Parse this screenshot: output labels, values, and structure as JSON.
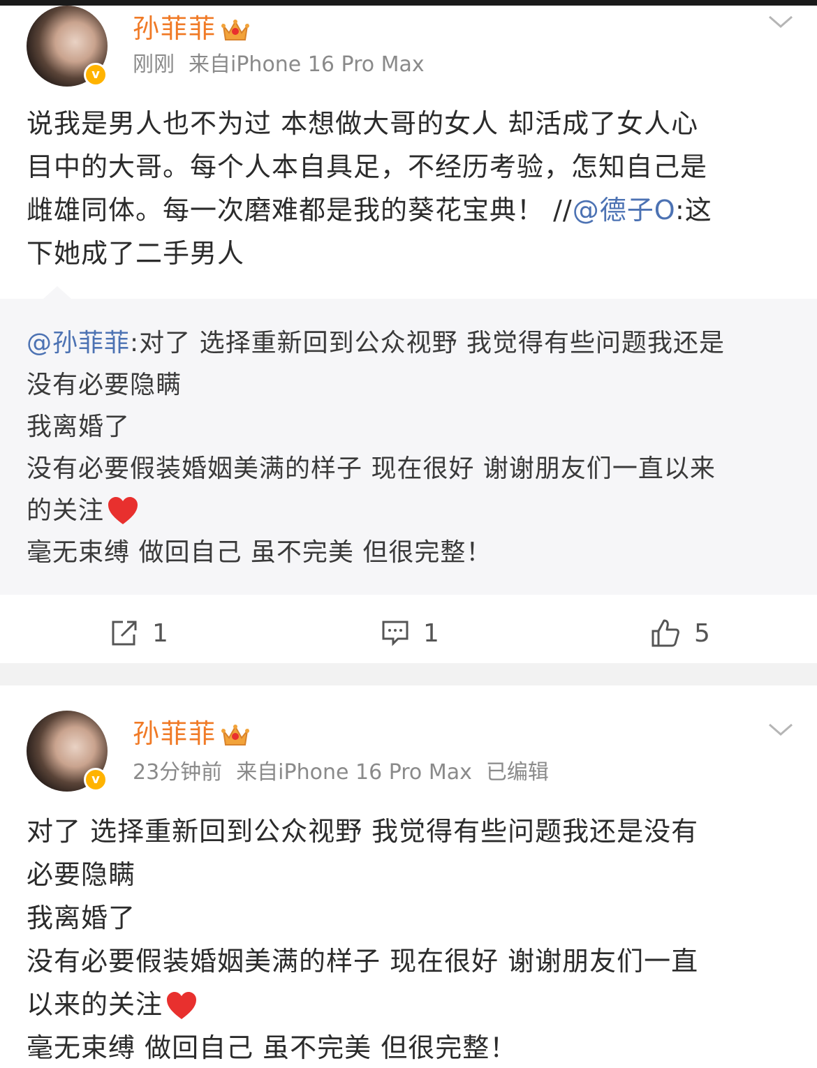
{
  "posts": [
    {
      "username": "孙菲菲",
      "time": "刚刚",
      "source": "来自iPhone 16 Pro Max",
      "edited": "",
      "content_lines": [
        "说我是男人也不为过 本想做大哥的女人 却活成了女人心",
        "目中的大哥。每个人本自具足，不经历考验，怎知自己是",
        "雌雄同体。每一次磨难都是我的葵花宝典！",
        "下她成了二手男人"
      ],
      "content_line3_suffix": "//",
      "content_mention": "@德子O",
      "content_after_mention": ":这",
      "repost": {
        "mention": "@孙菲菲",
        "lines": [
          ":对了 选择重新回到公众视野 我觉得有些问题我还是",
          "没有必要隐瞒",
          "我离婚了",
          "没有必要假装婚姻美满的样子 现在很好 谢谢朋友们一直以来",
          "的关注",
          "毫无束缚 做回自己 虽不完美 但很完整！"
        ]
      },
      "actions": {
        "repost_count": "1",
        "comment_count": "1",
        "like_count": "5"
      }
    },
    {
      "username": "孙菲菲",
      "time": "23分钟前",
      "source": "来自iPhone 16 Pro Max",
      "edited": "已编辑",
      "content_lines": [
        "对了 选择重新回到公众视野 我觉得有些问题我还是没有",
        "必要隐瞒",
        "我离婚了",
        "没有必要假装婚姻美满的样子 现在很好 谢谢朋友们一直",
        "以来的关注",
        "毫无束缚 做回自己 虽不完美 但很完整！"
      ]
    }
  ],
  "colors": {
    "username": "#f07a26",
    "mention": "#4c72b3",
    "meta": "#8a8a8a",
    "verified": "#ffb300",
    "heart": "#e8302e"
  }
}
